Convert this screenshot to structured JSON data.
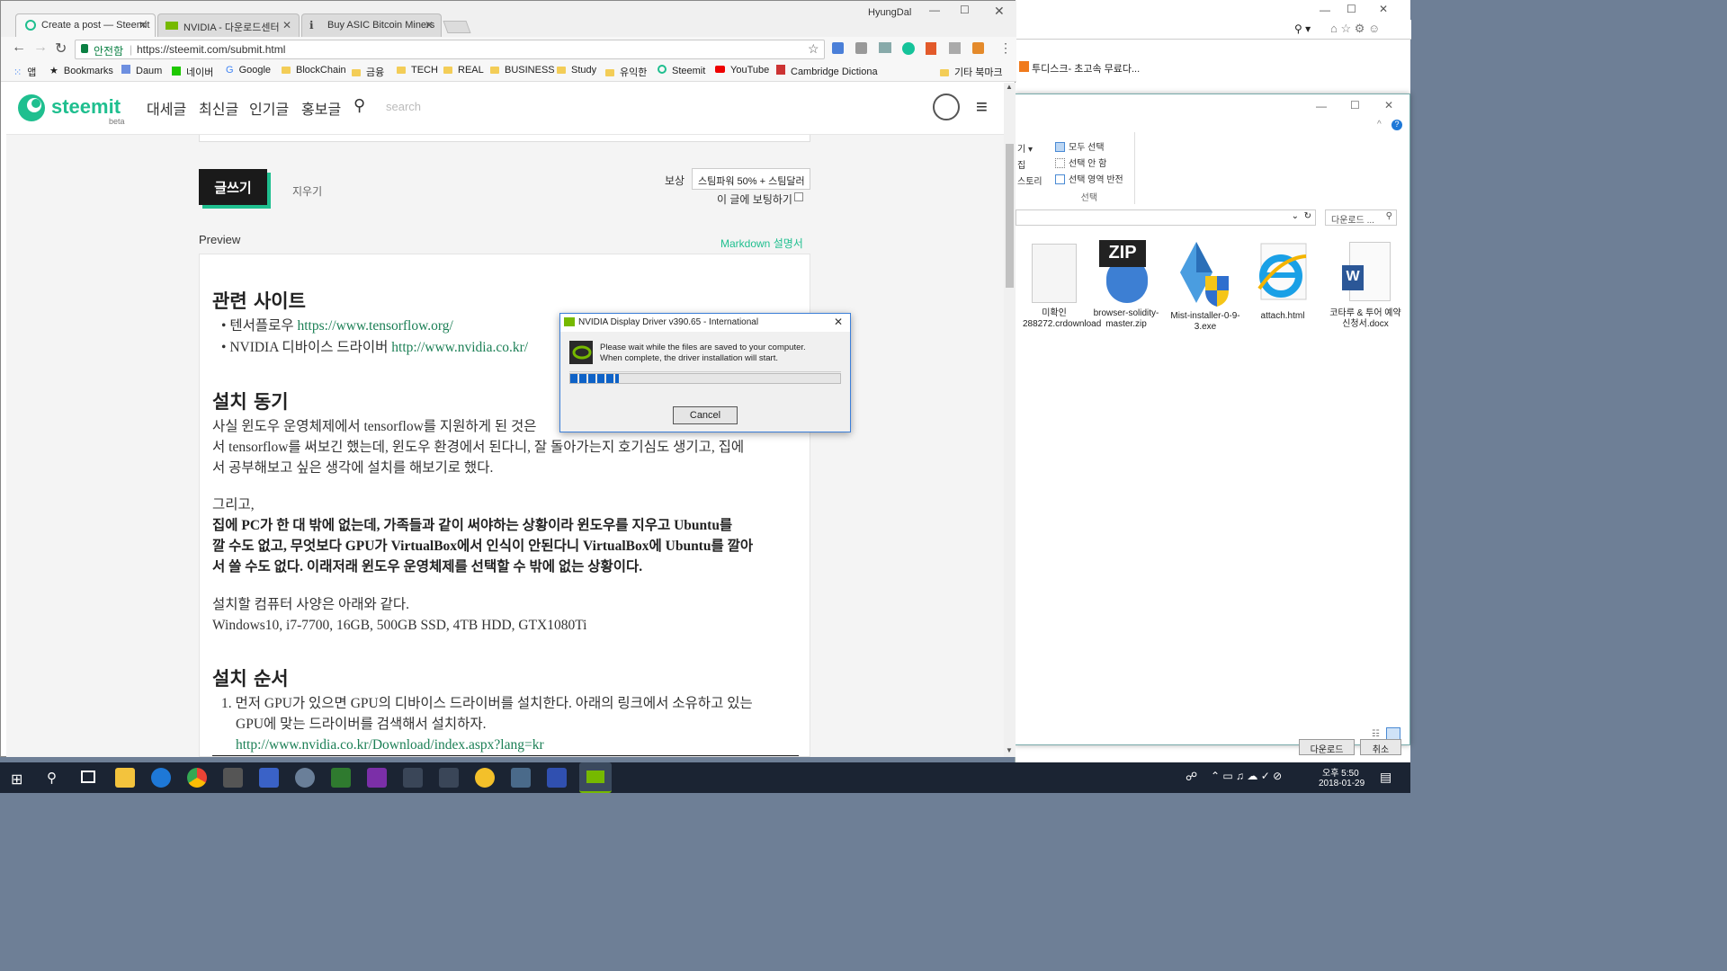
{
  "chrome": {
    "user": "HyungDal",
    "tabs": [
      {
        "label": "Create a post — Steemit"
      },
      {
        "label": "NVIDIA - 다운로드센터"
      },
      {
        "label": "Buy ASIC Bitcoin Miners"
      }
    ],
    "secure_label": "안전함",
    "url": "https://steemit.com/submit.html",
    "bookmarks": [
      "앱",
      "Bookmarks",
      "Daum",
      "네이버",
      "Google",
      "BlockChain",
      "금융",
      "TECH",
      "REAL",
      "BUSINESS",
      "Study",
      "유익한",
      "Steemit",
      "YouTube",
      "Cambridge Dictiona",
      "기타 북마크"
    ]
  },
  "steemit": {
    "logo": "steemit",
    "beta": "beta",
    "nav": [
      "대세글",
      "최신글",
      "인기글",
      "홍보글"
    ],
    "search_placeholder": "search",
    "submit": "글쓰기",
    "clear": "지우기",
    "reward_label": "보상",
    "reward_value": "스팀파워 50% + 스팀달러",
    "upvote_label": "이 글에 보팅하기",
    "preview_label": "Preview",
    "markdown_link": "Markdown 설명서"
  },
  "preview": {
    "h_related": "관련 사이트",
    "li1_text": "텐서플로우 ",
    "li1_link": "https://www.tensorflow.org/",
    "li2_text": "NVIDIA 디바이스 드라이버 ",
    "li2_link": "http://www.nvidia.co.kr/",
    "h_motive": "설치 동기",
    "p1": "사실 윈도우 운영체제에서 tensorflow를 지원하게 된 것은",
    "p1b": "서 tensorflow를 써보긴 했는데, 윈도우 환경에서 된다니, 잘 돌아가는지 호기심도 생기고, 집에",
    "p1c": "서 공부해보고 싶은 생각에 설치를 해보기로 했다.",
    "p2": "그리고,",
    "p3a": "집에 PC가 한 대 밖에 없는데, 가족들과 같이 써야하는 상황이라 윈도우를 지우고 Ubuntu를",
    "p3b": "깔 수도 없고, 무엇보다 GPU가 VirtualBox에서 인식이 안된다니 VirtualBox에 Ubuntu를 깔아",
    "p3c": "서 쓸 수도 없다. 이래저래 윈도우 운영체제를 선택할 수 밖에 없는 상황이다.",
    "p4": "설치할 컴퓨터 사양은 아래와 같다.",
    "p5": "Windows10, i7-7700, 16GB, 500GB SSD, 4TB HDD, GTX1080Ti",
    "h_order": "설치 순서",
    "step1a": "먼저 GPU가 있으면 GPU의 디바이스 드라이버를 설치한다. 아래의 링크에서 소유하고 있는",
    "step1b": "GPU에 맞는 드라이버를 검색해서 설치하자.",
    "step1_link": "http://www.nvidia.co.kr/Download/index.aspx?lang=kr"
  },
  "dialog": {
    "title": "NVIDIA Display Driver v390.65 - International",
    "line1": "Please wait while the files are saved to your computer.",
    "line2": "When complete, the driver installation will start.",
    "progress": 0.18,
    "cancel": "Cancel"
  },
  "ie": {
    "fav": "투디스크- 초고속 무료다..."
  },
  "explorer": {
    "select_all": "모두 선택",
    "select_none": "선택 안 함",
    "invert": "선택 영역 반전",
    "group": "선택",
    "left1": "기 ▾",
    "left2": "집",
    "left3": "스토리",
    "search": "다운로드 ...",
    "files": [
      {
        "name": "미확인 288272.crdownload"
      },
      {
        "name": "browser-solidity-master.zip"
      },
      {
        "name": "Mist-installer-0-9-3.exe"
      },
      {
        "name": "attach.html"
      },
      {
        "name": "코타루 & 투어 예약 신청서.docx"
      }
    ],
    "zip": "ZIP",
    "btn_open": "다운로드",
    "btn_cancel": "취소"
  },
  "taskbar": {
    "time": "오후 5:50",
    "date": "2018-01-29"
  }
}
